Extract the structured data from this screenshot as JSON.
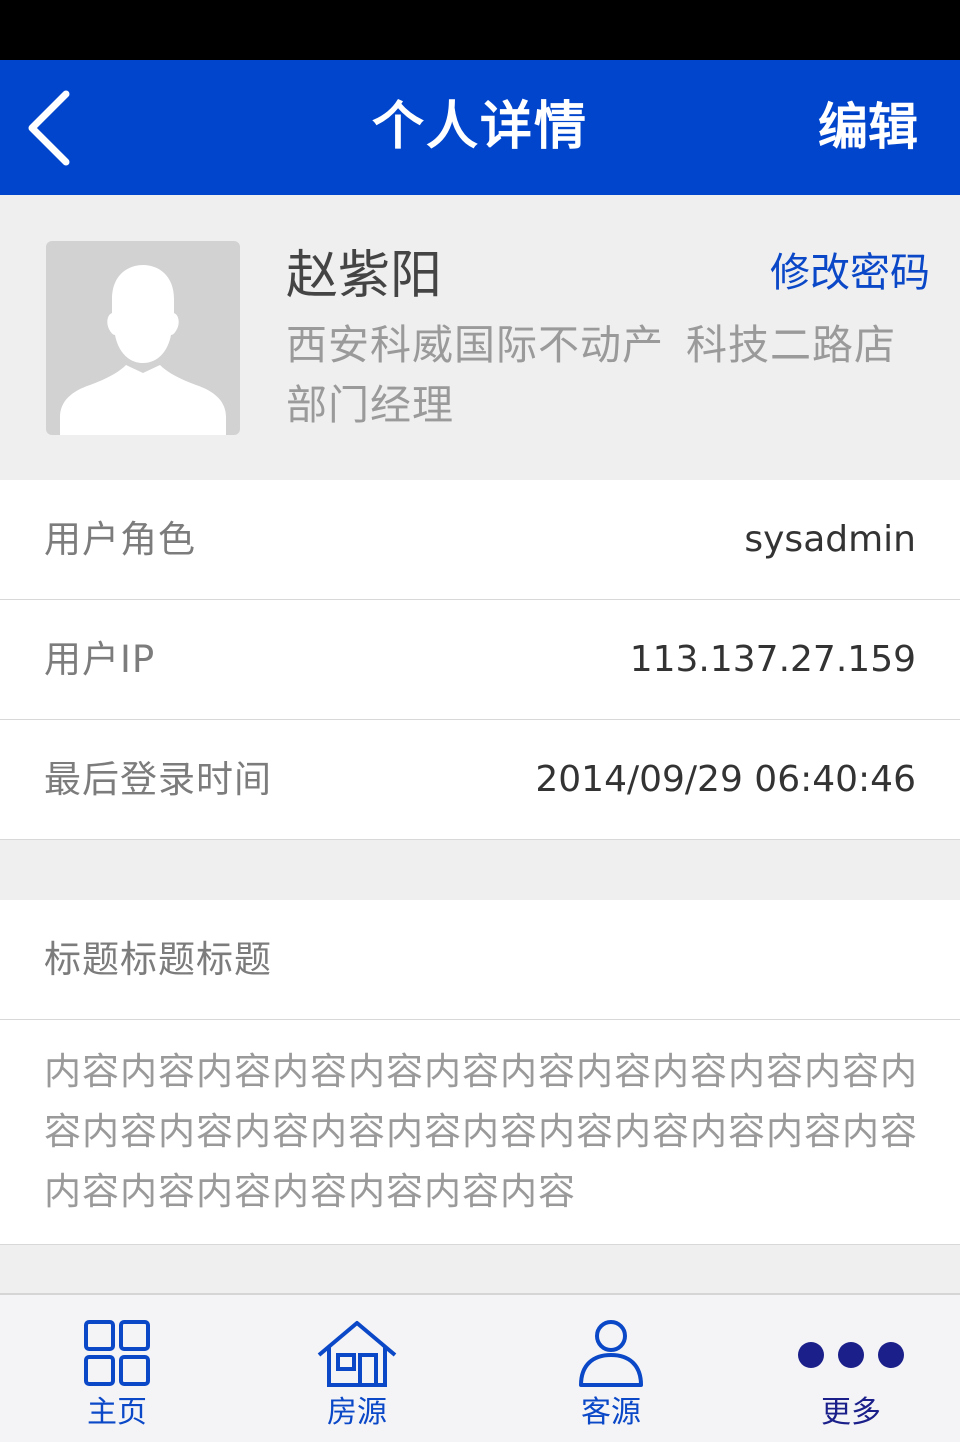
{
  "header": {
    "title": "个人详情",
    "edit_label": "编辑"
  },
  "profile": {
    "name": "赵紫阳",
    "change_password_label": "修改密码",
    "company": "西安科威国际不动产",
    "store": "科技二路店",
    "position": "部门经理"
  },
  "info": [
    {
      "label": "用户角色",
      "value": "sysadmin"
    },
    {
      "label": "用户IP",
      "value": "113.137.27.159"
    },
    {
      "label": "最后登录时间",
      "value": "2014/09/29 06:40:46"
    }
  ],
  "notice": {
    "title": "标题标题标题",
    "content": "内容内容内容内容内容内容内容内容内容内容内容内容内容内容内容内容内容内容内容内容内容内容内容内容内容内容内容内容内容内容"
  },
  "tabs": [
    {
      "label": "主页",
      "icon": "grid-icon",
      "color": "#0a48c8"
    },
    {
      "label": "房源",
      "icon": "house-icon",
      "color": "#0a48c8"
    },
    {
      "label": "客源",
      "icon": "person-icon",
      "color": "#0a48c8"
    },
    {
      "label": "更多",
      "icon": "more-dots-icon",
      "color": "#1a1f8a"
    }
  ],
  "colors": {
    "nav_background": "#0045cc",
    "link": "#0a48c8",
    "more_active": "#1a1f8a"
  }
}
